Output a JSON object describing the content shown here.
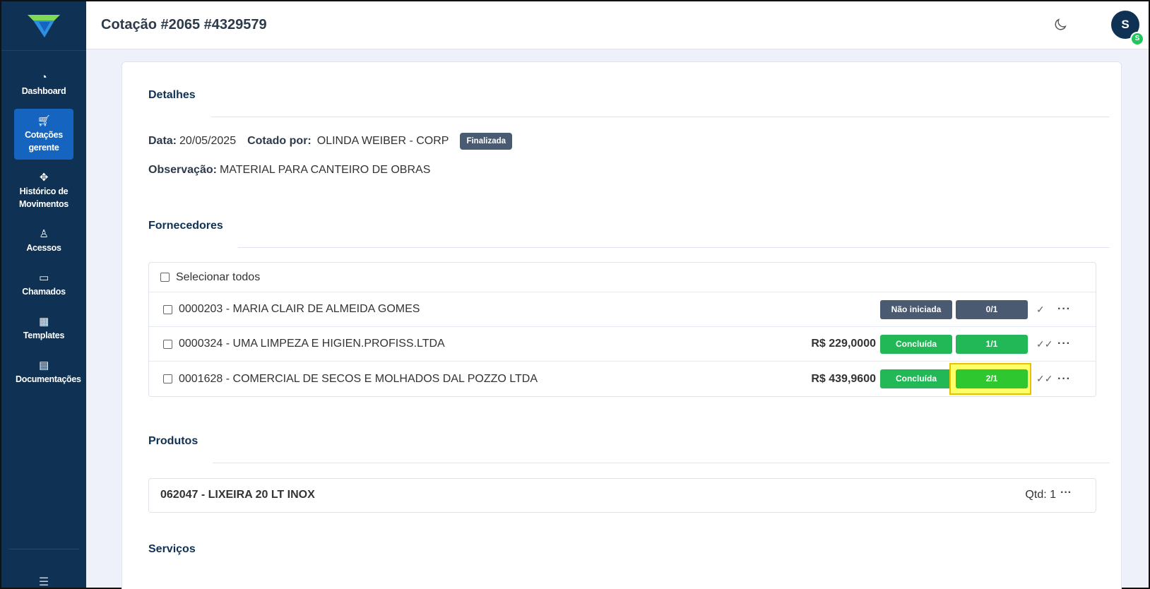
{
  "sidebar": {
    "items": [
      {
        "label": "Dashboard",
        "icon": "gauge-icon"
      },
      {
        "label": "Cotações gerente",
        "icon": "cart-icon",
        "active": true
      },
      {
        "label": "Histórico de Movimentos",
        "icon": "move-icon"
      },
      {
        "label": "Acessos",
        "icon": "user-key-icon"
      },
      {
        "label": "Chamados",
        "icon": "ticket-icon"
      },
      {
        "label": "Templates",
        "icon": "template-icon"
      },
      {
        "label": "Documentações",
        "icon": "document-icon"
      }
    ],
    "bottom_icon": "settings-sliders-icon"
  },
  "header": {
    "title": "Cotação #2065 #4329579",
    "avatar_letter": "S",
    "avatar_badge": "S"
  },
  "detalhes": {
    "title": "Detalhes",
    "data_label": "Data:",
    "data_value": "20/05/2025",
    "cotado_label": "Cotado por:",
    "cotado_value": "OLINDA WEIBER - CORP",
    "status_badge": "Finalizada",
    "obs_label": "Observação:",
    "obs_value": "MATERIAL PARA CANTEIRO DE OBRAS"
  },
  "fornecedores": {
    "title": "Fornecedores",
    "select_all": "Selecionar todos",
    "rows": [
      {
        "name": "0000203 - MARIA CLAIR DE ALMEIDA GOMES",
        "price": "",
        "status": "Não iniciada",
        "count": "0/1"
      },
      {
        "name": "0000324 - UMA LIMPEZA E HIGIEN.PROFISS.LTDA",
        "price": "R$ 229,0000",
        "status": "Concluída",
        "count": "1/1"
      },
      {
        "name": "0001628 - COMERCIAL DE SECOS E MOLHADOS DAL POZZO LTDA",
        "price": "R$ 439,9600",
        "status": "Concluída",
        "count": "2/1"
      }
    ]
  },
  "produtos": {
    "title": "Produtos",
    "item": "062047 - LIXEIRA 20 LT INOX",
    "qtd": "Qtd: 1"
  },
  "servicos": {
    "title": "Serviços"
  },
  "colors": {
    "sidebar": "#0e3154",
    "active": "#1565c0",
    "status_grey": "#4a5a70",
    "status_green": "#22b857",
    "highlight": "#ffff66"
  }
}
